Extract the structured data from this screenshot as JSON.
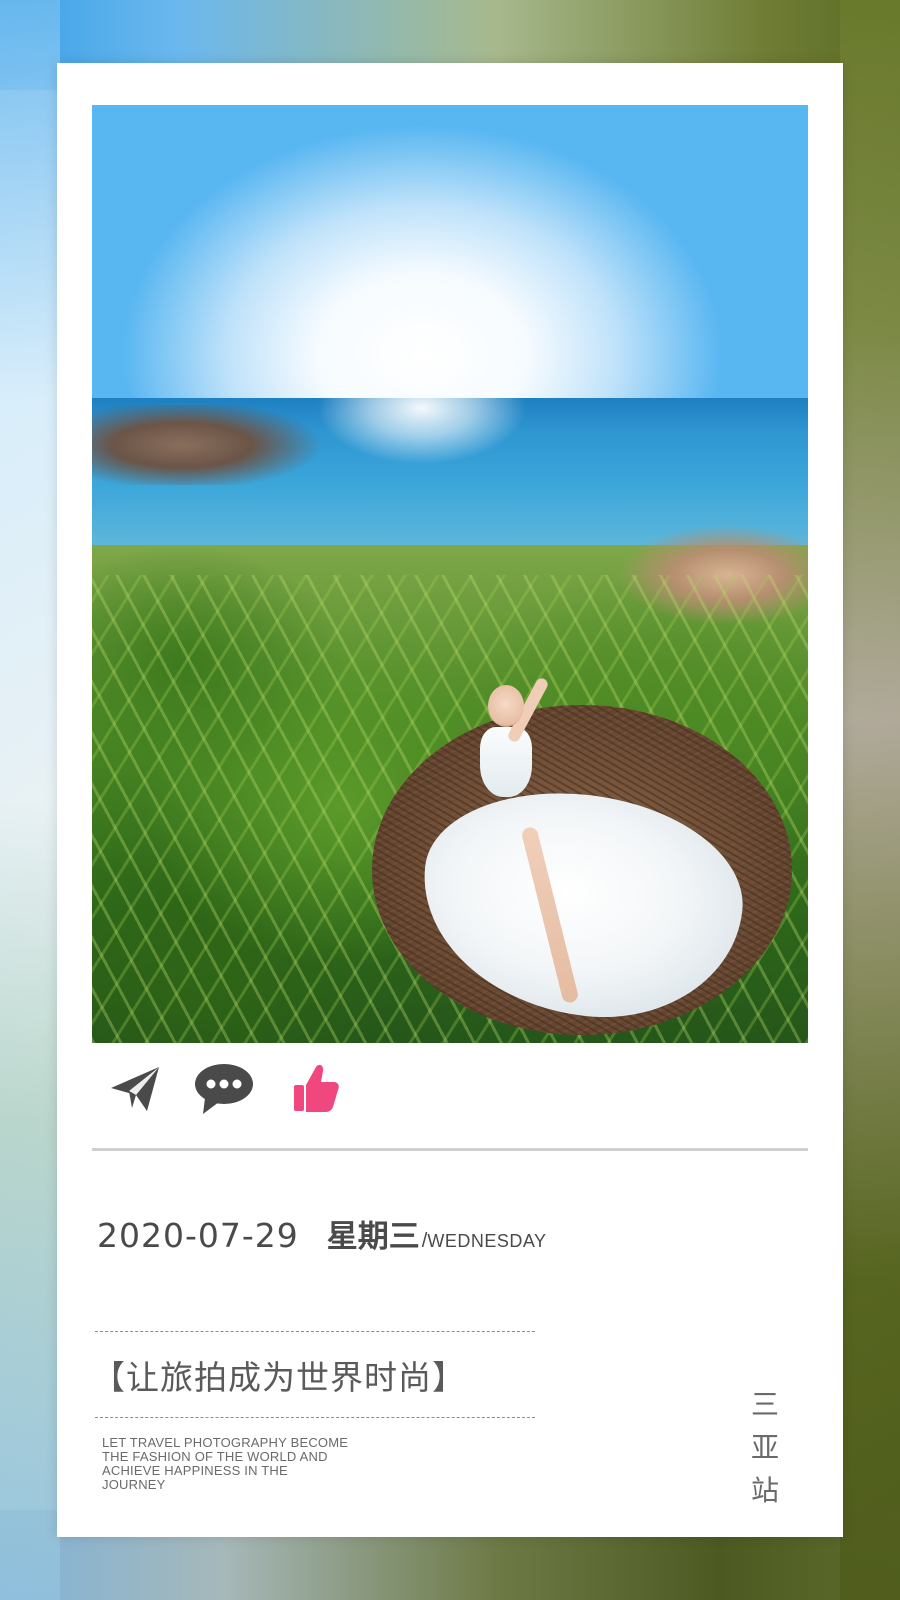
{
  "actions": {
    "send_icon": "paper-plane-icon",
    "comment_icon": "speech-bubble-icon",
    "like_icon": "thumbs-up-icon",
    "icon_color": "#4a4a4a",
    "like_color": "#f0487e"
  },
  "post": {
    "date": "2020-07-29",
    "weekday_cn": "星期三",
    "weekday_sep": "/",
    "weekday_en": "WEDNESDAY",
    "slogan": "【让旅拍成为世界时尚】",
    "english_lines": [
      "LET TRAVEL PHOTOGRAPHY BECOME",
      "THE FASHION OF THE WORLD AND",
      "ACHIEVE HAPPINESS IN THE",
      "JOURNEY"
    ],
    "vertical_title": [
      "三",
      "亚",
      "站"
    ]
  },
  "colors": {
    "card_bg": "#ffffff",
    "text_primary": "#4a4a4a",
    "divider": "#cfcfcf"
  }
}
